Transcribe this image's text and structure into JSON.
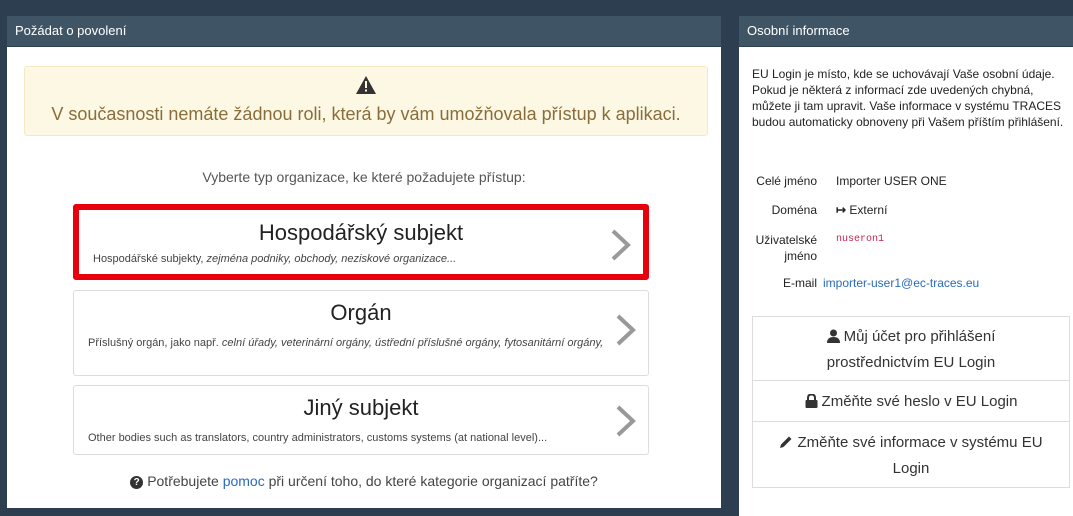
{
  "left_panel": {
    "title": "Požádat o povolení",
    "warning": "V současnosti nemáte žádnou roli, která by vám umožňovala přístup k aplikaci.",
    "choose_prompt": "Vyberte typ organizace, ke které požadujete přístup:",
    "cards": [
      {
        "title": "Hospodářský subjekt",
        "desc_plain": "Hospodářské subjekty, ",
        "desc_italic": "zejména podniky, obchody, neziskové organizace..."
      },
      {
        "title": "Orgán",
        "desc_plain": "Příslušný orgán, jako např. ",
        "desc_italic": "celní úřady, veterinární orgány, ústřední příslušné orgány, fytosanitární orgány,"
      },
      {
        "title": "Jiný subjekt",
        "desc_plain": "Other bodies such as translators, country administrators, customs systems (at national level)..."
      }
    ],
    "help": {
      "before": "Potřebujete ",
      "link": "pomoc",
      "after": " při určení toho, do které kategorie organizací patříte?"
    }
  },
  "right_panel": {
    "title": "Osobní informace",
    "intro": "EU Login je místo, kde se uchovávají Vaše osobní údaje. Pokud je některá z informací zde uvedených chybná, můžete ji tam upravit. Vaše informace v systému TRACES budou automaticky obnoveny při Vašem příštím přihlášení.",
    "fields": {
      "full_name_label": "Celé jméno",
      "full_name": "Importer USER ONE",
      "domain_label": "Doména",
      "domain": "Externí",
      "username_label_1": "Uživatelské",
      "username_label_2": "jméno",
      "username": "nuseron1",
      "email_label": "E-mail",
      "email": "importer-user1@ec-traces.eu"
    },
    "buttons": {
      "account_line1": "Můj účet pro přihlášení",
      "account_line2": "prostřednictvím EU Login",
      "password": "Změňte své heslo v EU Login",
      "info_line1": "Změňte své informace v systému EU",
      "info_line2": "Login"
    }
  }
}
